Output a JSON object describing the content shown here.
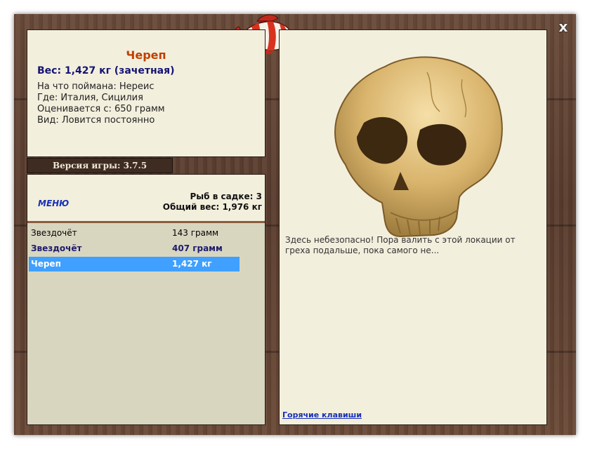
{
  "header": {
    "close_label": "x"
  },
  "fish_info": {
    "name": "Череп",
    "weight": "Вес: 1,427 кг (зачетная)",
    "caught_on": "На что поймана: Нереис",
    "where": "Где: Италия, Сицилия",
    "valued_from": "Оценивается с: 650 грамм",
    "species": "Вид: Ловится постоянно"
  },
  "version": "Версия игры: 3.7.5",
  "keepnet": {
    "menu_label": "МЕНЮ",
    "count": "Рыб в садке: 3",
    "total_weight": "Общий вес: 1,976 кг",
    "items": [
      {
        "name": "Звездочёт",
        "weight": "143 грамм"
      },
      {
        "name": "Звездочёт",
        "weight": "407 грамм"
      },
      {
        "name": "Череп",
        "weight": "1,427 кг"
      }
    ]
  },
  "detail": {
    "description": "Здесь небезопасно! Пора валить с этой локации от греха подальше, пока самого не...",
    "hotkeys_label": "Горячие клавиши"
  },
  "colors": {
    "wood": "#5a3d2f",
    "panel": "#f3efdd",
    "list_bg": "#d9d6c0",
    "selected": "#3fa0ff",
    "title": "#c04000",
    "link": "#1630b8"
  },
  "icons": {
    "close": "close-icon",
    "fish": "fish-icon",
    "skull": "skull-image"
  }
}
